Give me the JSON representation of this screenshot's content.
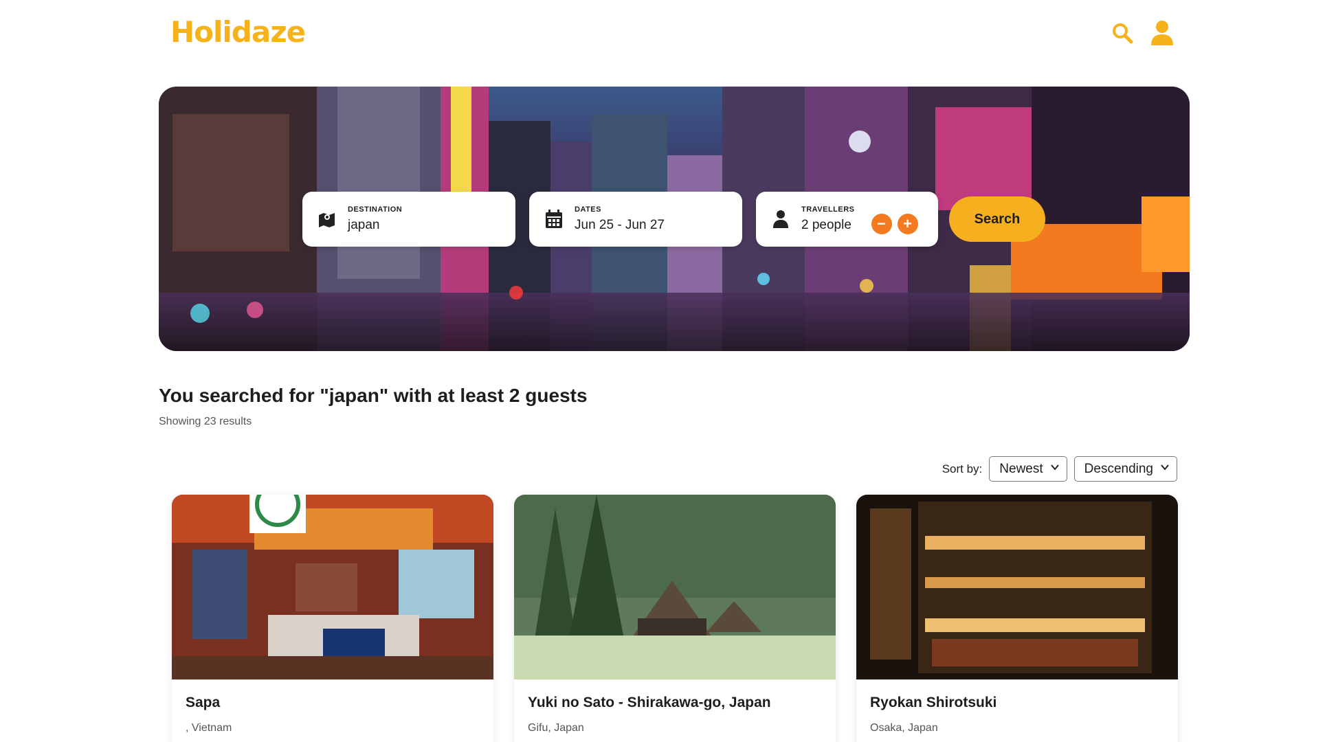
{
  "header": {
    "logo": "Holidaze",
    "search_icon": "search-icon",
    "profile_icon": "user-icon"
  },
  "hero": {
    "destination": {
      "label": "DESTINATION",
      "value": "japan",
      "icon": "map-icon"
    },
    "dates": {
      "label": "DATES",
      "value": "Jun 25 - Jun 27",
      "icon": "calendar-icon"
    },
    "travellers": {
      "label": "TRAVELLERS",
      "value": "2 people",
      "icon": "person-icon",
      "minus": "−",
      "plus": "+"
    },
    "search_button": "Search"
  },
  "results": {
    "title": "You searched for \"japan\" with at least 2 guests",
    "count": "Showing 23 results"
  },
  "sort": {
    "label": "Sort by:",
    "field": "Newest",
    "order": "Descending"
  },
  "cards": [
    {
      "title": "Sapa",
      "location": ", Vietnam"
    },
    {
      "title": "Yuki no Sato - Shirakawa-go, Japan",
      "location": "Gifu, Japan"
    },
    {
      "title": "Ryokan Shirotsuki",
      "location": "Osaka, Japan"
    }
  ],
  "colors": {
    "brand": "#f5b21b",
    "accent_orange": "#f47a1f"
  }
}
